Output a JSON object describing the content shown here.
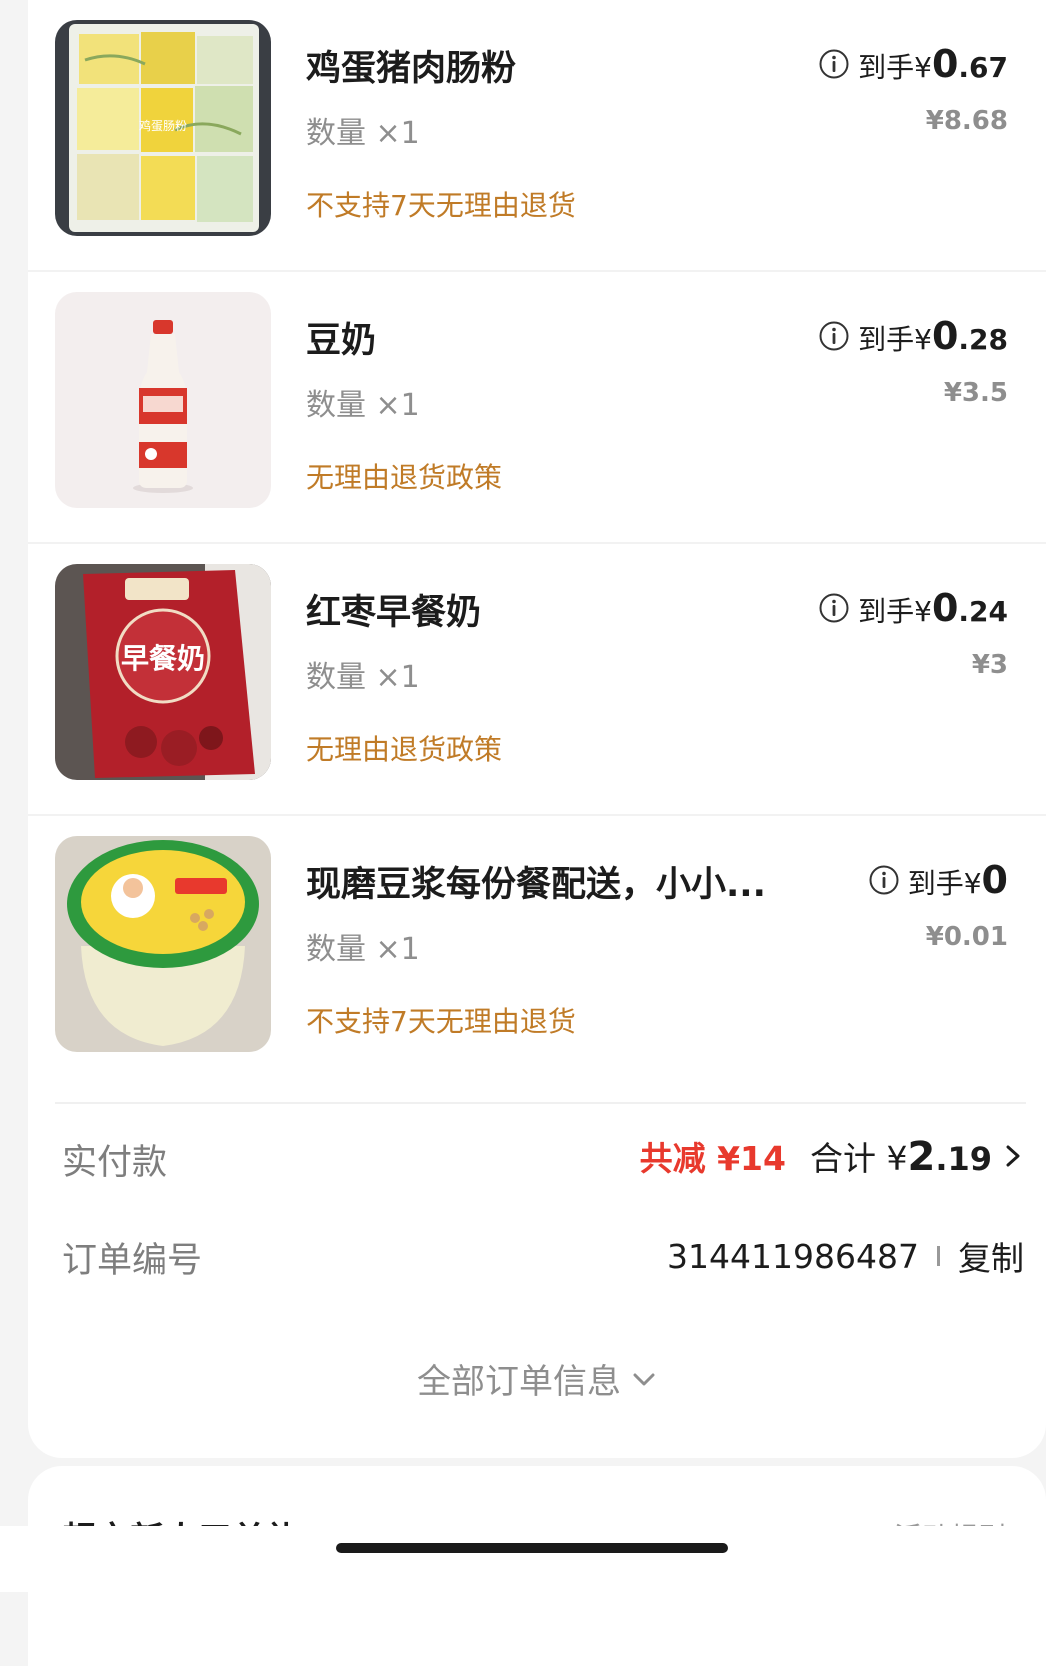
{
  "items": [
    {
      "name": "鸡蛋猪肉肠粉",
      "qty": "数量 ×1",
      "policy": "不支持7天无理由退货",
      "net_label": "到手¥",
      "net_int": "0",
      "net_dec": ".67",
      "orig": "¥8.68",
      "thumb_label": "鸡蛋肠粉",
      "image": "rice-roll-photo"
    },
    {
      "name": "豆奶",
      "qty": "数量 ×1",
      "policy": "无理由退货政策",
      "net_label": "到手¥",
      "net_int": "0",
      "net_dec": ".28",
      "orig": "¥3.5",
      "image": "soy-milk-bottle-photo"
    },
    {
      "name": "红枣早餐奶",
      "qty": "数量 ×1",
      "policy": "无理由退货政策",
      "net_label": "到手¥",
      "net_int": "0",
      "net_dec": ".24",
      "orig": "¥3",
      "thumb_label": "早餐奶",
      "image": "breakfast-milk-carton-photo"
    },
    {
      "name": "现磨豆浆每份餐配送，小小...",
      "qty": "数量 ×1",
      "policy": "不支持7天无理由退货",
      "net_label": "到手¥",
      "net_int": "0",
      "net_dec": "",
      "orig": "¥0.01",
      "image": "soybean-milk-cup-photo"
    }
  ],
  "payment": {
    "label": "实付款",
    "discount": "共减 ¥14",
    "total_label": "合计 ¥",
    "total_int": "2",
    "total_dec": ".19"
  },
  "order": {
    "label": "订单编号",
    "number": "314411986487",
    "copy": "复制"
  },
  "all_info": "全部订单信息",
  "promo": {
    "title": "超市新人三单礼",
    "link": "活动规则"
  },
  "colors": {
    "policy": "#c07b27",
    "discount": "#e8392d",
    "muted": "#8e8e8e"
  },
  "icons": [
    "info-icon",
    "chevron-right-icon",
    "chevron-down-icon"
  ]
}
